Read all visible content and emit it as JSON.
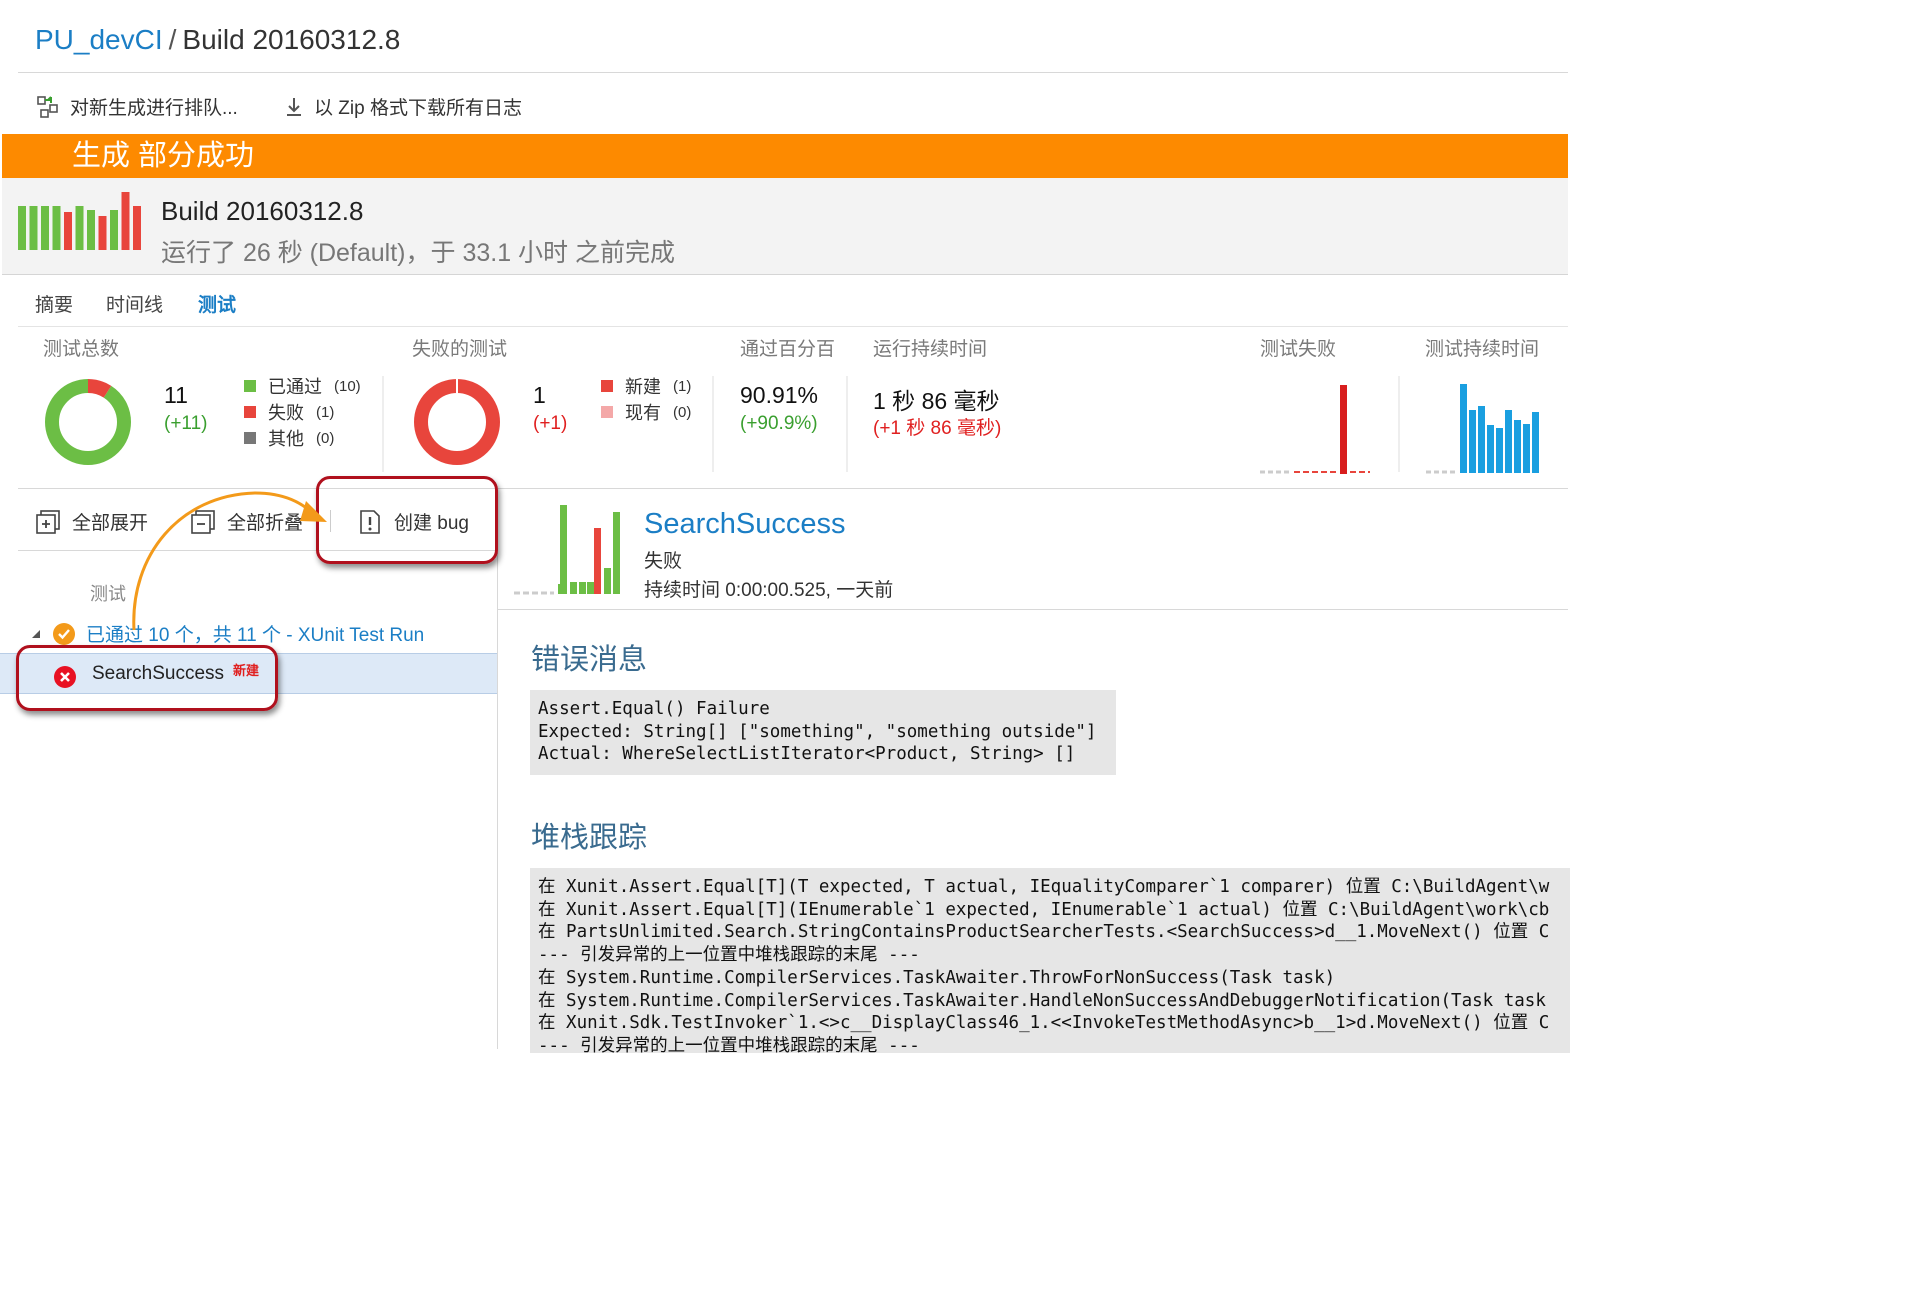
{
  "header": {
    "project_link": "PU_devCI",
    "separator": "/",
    "build_name": "Build 20160312.8"
  },
  "toolbar": {
    "queue_label": "对新生成进行排队...",
    "download_label": "以 Zip 格式下载所有日志"
  },
  "banner": {
    "status_text": "生成 部分成功"
  },
  "build": {
    "title": "Build 20160312.8",
    "subtitle": "运行了 26 秒 (Default)，于 33.1 小时 之前完成",
    "history_bar_colors": [
      "#6cbe45",
      "#6cbe45",
      "#6cbe45",
      "#6cbe45",
      "#e8453c",
      "#6cbe45",
      "#6cbe45",
      "#e8453c",
      "#6cbe45",
      "#e8453c",
      "#e8453c"
    ]
  },
  "tabs": [
    {
      "label": "摘要",
      "active": false
    },
    {
      "label": "时间线",
      "active": false
    },
    {
      "label": "测试",
      "active": true
    }
  ],
  "stats": {
    "total": {
      "label": "测试总数",
      "value": "11",
      "delta": "(+11)",
      "donut": {
        "passed": 10,
        "failed": 1,
        "other": 0
      },
      "legend": [
        {
          "name": "已通过",
          "count": "(10)",
          "color": "#6cbe45"
        },
        {
          "name": "失败",
          "count": "(1)",
          "color": "#e8453c"
        },
        {
          "name": "其他",
          "count": "(0)",
          "color": "#777777"
        }
      ]
    },
    "failed": {
      "label": "失败的测试",
      "value": "1",
      "delta": "(+1)",
      "legend": [
        {
          "name": "新建",
          "count": "(1)",
          "color": "#e8453c"
        },
        {
          "name": "现有",
          "count": "(0)",
          "color": "#f4a8a8"
        }
      ]
    },
    "pass_rate": {
      "label": "通过百分百",
      "value": "90.91%",
      "delta": "(+90.9%)"
    },
    "duration": {
      "label": "运行持续时间",
      "value": "1 秒 86 毫秒",
      "delta": "(+1 秒 86 毫秒)"
    },
    "failure_trend": {
      "label": "测试失败"
    },
    "duration_trend": {
      "label": "测试持续时间"
    }
  },
  "left_toolbar": {
    "expand_all": "全部展开",
    "collapse_all": "全部折叠",
    "create_bug": "创建 bug"
  },
  "test_tree": {
    "column_header": "测试",
    "group": {
      "label": "已通过 10 个，共 11 个 - XUnit Test Run"
    },
    "selected": {
      "name": "SearchSuccess",
      "badge": "新建"
    }
  },
  "detail": {
    "name": "SearchSuccess",
    "status": "失败",
    "duration": "持续时间 0:00:00.525, 一天前",
    "error_title": "错误消息",
    "error_message": "Assert.Equal() Failure\nExpected: String[] [\"something\", \"something outside\"]\nActual: WhereSelectListIterator<Product, String> []",
    "stack_title": "堆栈跟踪",
    "stack_trace": "在 Xunit.Assert.Equal[T](T expected, T actual, IEqualityComparer`1 comparer) 位置 C:\\BuildAgent\\w\n在 Xunit.Assert.Equal[T](IEnumerable`1 expected, IEnumerable`1 actual) 位置 C:\\BuildAgent\\work\\cb\n在 PartsUnlimited.Search.StringContainsProductSearcherTests.<SearchSuccess>d__1.MoveNext() 位置 C\n--- 引发异常的上一位置中堆栈跟踪的末尾 ---\n在 System.Runtime.CompilerServices.TaskAwaiter.ThrowForNonSuccess(Task task)\n在 System.Runtime.CompilerServices.TaskAwaiter.HandleNonSuccessAndDebuggerNotification(Task task\n在 Xunit.Sdk.TestInvoker`1.<>c__DisplayClass46_1.<<InvokeTestMethodAsync>b__1>d.MoveNext() 位置 C\n--- 引发异常的上一位置中堆栈跟踪的末尾 ---"
  }
}
